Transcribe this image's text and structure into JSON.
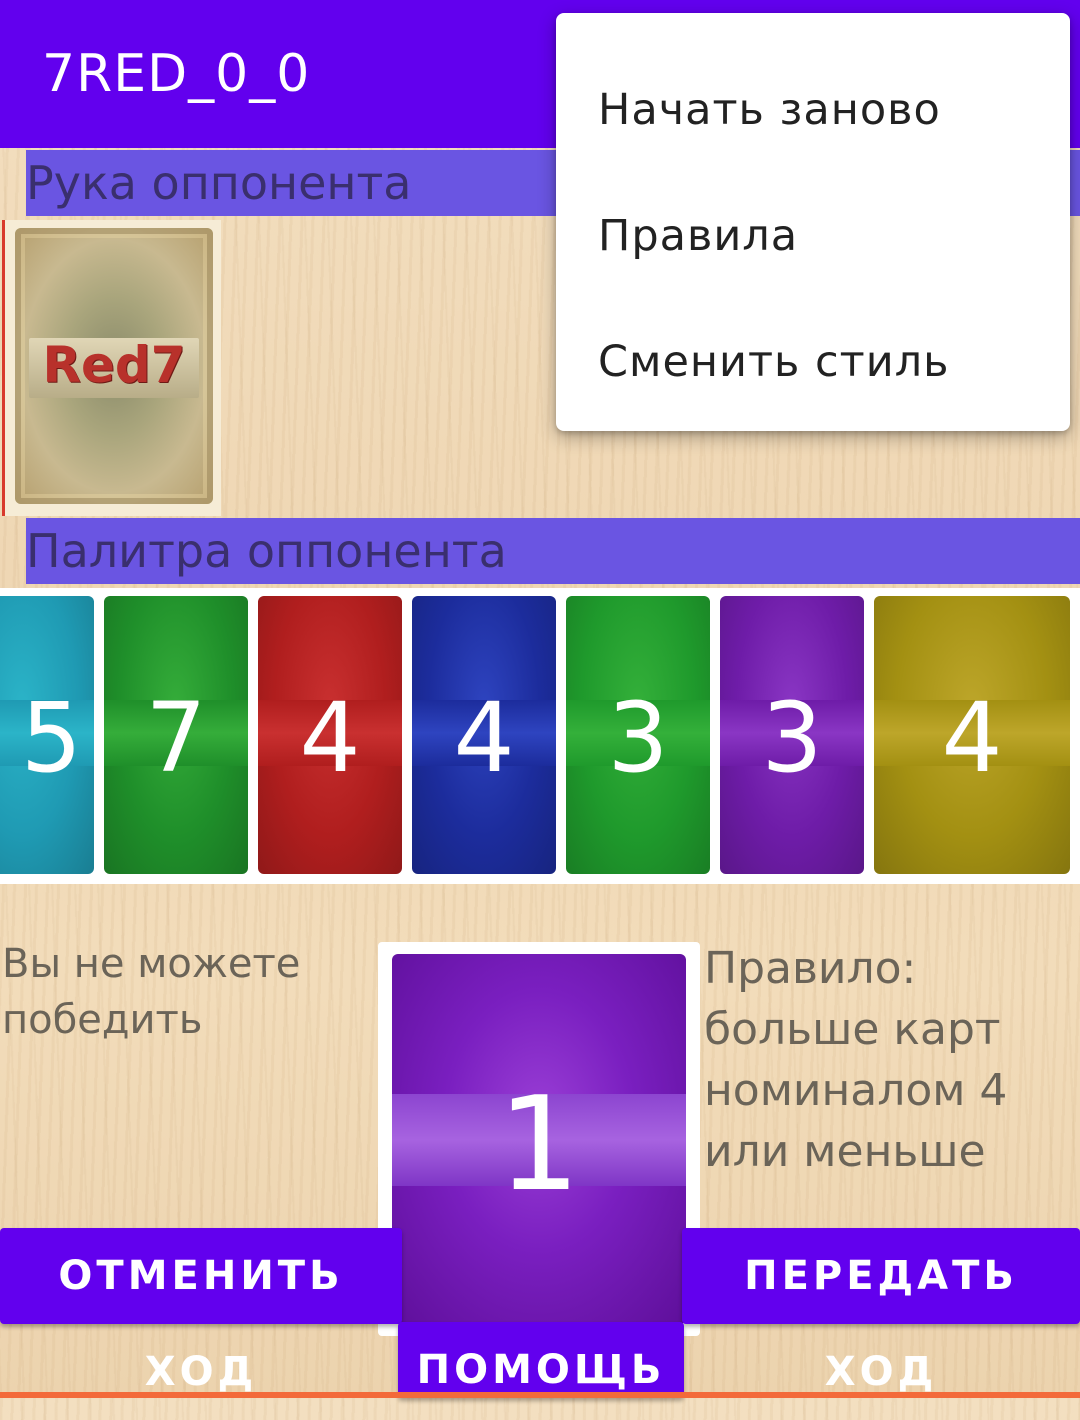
{
  "app": {
    "title": "7RED_0_0"
  },
  "sections": {
    "opponent_hand": "Рука оппонента",
    "opponent_palette": "Палитра оппонента"
  },
  "opponent_hand": {
    "card_back_logo": "Red7"
  },
  "opponent_palette": {
    "cards": [
      {
        "value": "5",
        "color": "#1f9ab3",
        "band": "#2bb4c8"
      },
      {
        "value": "7",
        "color": "#1f8f2a",
        "band": "#35ad3a"
      },
      {
        "value": "4",
        "color": "#b01e1e",
        "band": "#c93030"
      },
      {
        "value": "4",
        "color": "#1c2c9c",
        "band": "#2e44c0"
      },
      {
        "value": "3",
        "color": "#1f9a2c",
        "band": "#34b03a"
      },
      {
        "value": "3",
        "color": "#6e1ca8",
        "band": "#8a36c4"
      },
      {
        "value": "4",
        "color": "#a39012",
        "band": "#bda62a"
      }
    ]
  },
  "status": {
    "text": "Вы не можете победить"
  },
  "rule": {
    "text": "Правило: больше карт номиналом 4 или меньше"
  },
  "current_card": {
    "value": "1",
    "color": "#7a1fc0"
  },
  "buttons": {
    "undo": "ОТМЕНИТЬ ХОД",
    "pass": "ПЕРЕДАТЬ ХОД",
    "help": "ПОМОЩЬ"
  },
  "menu": {
    "items": [
      "Начать заново",
      "Правила",
      "Сменить стиль"
    ]
  },
  "colors": {
    "accent": "#6200ee",
    "section_header": "#6a55e2"
  }
}
